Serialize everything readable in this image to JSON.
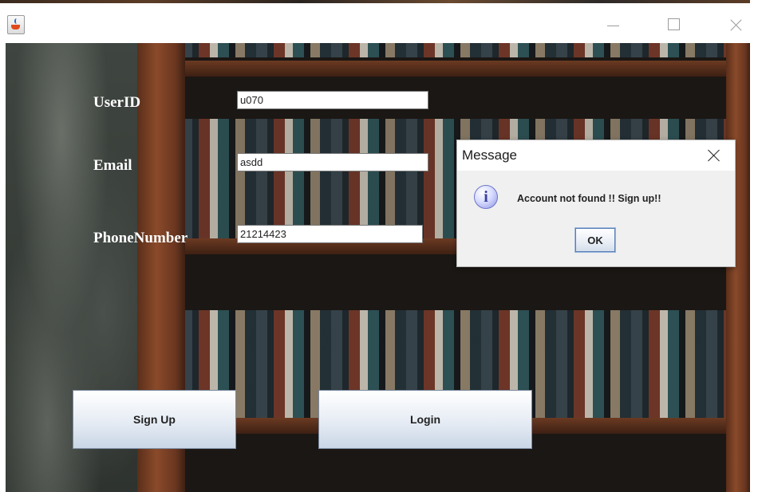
{
  "window": {
    "icon": "java-cup-icon"
  },
  "form": {
    "userid_label": "UserID",
    "userid_value": "u070",
    "email_label": "Email",
    "email_value": "asdd",
    "phone_label": "PhoneNumber",
    "phone_value": "21214423",
    "signup_label": "Sign Up",
    "login_label": "Login"
  },
  "dialog": {
    "title": "Message",
    "icon": "info-icon",
    "message": "Account not found !! Sign up!!",
    "ok_label": "OK"
  }
}
